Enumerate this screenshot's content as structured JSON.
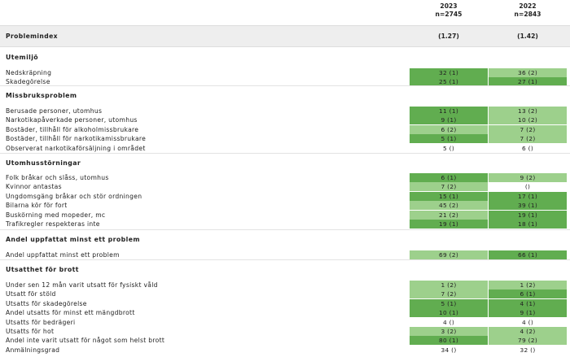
{
  "columns": [
    {
      "year": "2023",
      "n": "n=2745"
    },
    {
      "year": "2022",
      "n": "n=2843"
    }
  ],
  "problemindex": {
    "label": "Problemindex",
    "values": [
      "(1.27)",
      "(1.42)"
    ]
  },
  "colors": {
    "level1": "#61ad50",
    "level2": "#9dd08c",
    "none": "#ffffff",
    "band": "#eeeeee"
  },
  "sections": [
    {
      "title": "Utemiljö",
      "rows": [
        {
          "label": "Nedskräpning",
          "cells": [
            {
              "text": "32 (1)",
              "level": 1
            },
            {
              "text": "36 (2)",
              "level": 2
            }
          ]
        },
        {
          "label": "Skadegörelse",
          "cells": [
            {
              "text": "25 (1)",
              "level": 1
            },
            {
              "text": "27 (1)",
              "level": 1
            }
          ]
        }
      ]
    },
    {
      "title": "Missbruksproblem",
      "rows": [
        {
          "label": "Berusade personer, utomhus",
          "cells": [
            {
              "text": "11 (1)",
              "level": 1
            },
            {
              "text": "13 (2)",
              "level": 2
            }
          ]
        },
        {
          "label": "Narkotikapåverkade personer, utomhus",
          "cells": [
            {
              "text": "9 (1)",
              "level": 1
            },
            {
              "text": "10 (2)",
              "level": 2
            }
          ]
        },
        {
          "label": "Bostäder, tillhåll för alkoholmissbrukare",
          "cells": [
            {
              "text": "6 (2)",
              "level": 2
            },
            {
              "text": "7 (2)",
              "level": 2
            }
          ]
        },
        {
          "label": "Bostäder, tillhåll för narkotikamissbrukare",
          "cells": [
            {
              "text": "5 (1)",
              "level": 1
            },
            {
              "text": "7 (2)",
              "level": 2
            }
          ]
        },
        {
          "label": "Observerat narkotikaförsäljning i området",
          "cells": [
            {
              "text": "5 ()",
              "level": 0
            },
            {
              "text": "6 ()",
              "level": 0
            }
          ]
        }
      ]
    },
    {
      "title": "Utomhusstörningar",
      "rows": [
        {
          "label": "Folk bråkar och slåss, utomhus",
          "cells": [
            {
              "text": "6 (1)",
              "level": 1
            },
            {
              "text": "9 (2)",
              "level": 2
            }
          ]
        },
        {
          "label": "Kvinnor antastas",
          "cells": [
            {
              "text": "7 (2)",
              "level": 2
            },
            {
              "text": "()",
              "level": 0
            }
          ]
        },
        {
          "label": "Ungdomsgäng bråkar och stör ordningen",
          "cells": [
            {
              "text": "15 (1)",
              "level": 1
            },
            {
              "text": "17 (1)",
              "level": 1
            }
          ]
        },
        {
          "label": "Bilarna kör för fort",
          "cells": [
            {
              "text": "45 (2)",
              "level": 2
            },
            {
              "text": "39 (1)",
              "level": 1
            }
          ]
        },
        {
          "label": "Buskörning med mopeder, mc",
          "cells": [
            {
              "text": "21 (2)",
              "level": 2
            },
            {
              "text": "19 (1)",
              "level": 1
            }
          ]
        },
        {
          "label": "Trafikregler respekteras inte",
          "cells": [
            {
              "text": "19 (1)",
              "level": 1
            },
            {
              "text": "18 (1)",
              "level": 1
            }
          ]
        }
      ]
    },
    {
      "title": "Andel uppfattat minst ett problem",
      "rows": [
        {
          "label": "Andel uppfattat minst ett problem",
          "cells": [
            {
              "text": "69 (2)",
              "level": 2
            },
            {
              "text": "66 (1)",
              "level": 1
            }
          ]
        }
      ]
    },
    {
      "title": "Utsatthet för brott",
      "rows": [
        {
          "label": "Under sen 12 mån varit utsatt för fysiskt våld",
          "cells": [
            {
              "text": "1 (2)",
              "level": 2
            },
            {
              "text": "1 (2)",
              "level": 2
            }
          ]
        },
        {
          "label": "Utsatt för stöld",
          "cells": [
            {
              "text": "7 (2)",
              "level": 2
            },
            {
              "text": "6 (1)",
              "level": 1
            }
          ]
        },
        {
          "label": "Utsatts för skadegörelse",
          "cells": [
            {
              "text": "5 (1)",
              "level": 1
            },
            {
              "text": "4 (1)",
              "level": 1
            }
          ]
        },
        {
          "label": "Andel utsatts för minst ett mängdbrott",
          "cells": [
            {
              "text": "10 (1)",
              "level": 1
            },
            {
              "text": "9 (1)",
              "level": 1
            }
          ]
        },
        {
          "label": "Utsatts för bedrägeri",
          "cells": [
            {
              "text": "4 ()",
              "level": 0
            },
            {
              "text": "4 ()",
              "level": 0
            }
          ]
        },
        {
          "label": "Utsatts för hot",
          "cells": [
            {
              "text": "3 (2)",
              "level": 2
            },
            {
              "text": "4 (2)",
              "level": 2
            }
          ]
        },
        {
          "label": "Andel inte varit utsatt för något som helst brott",
          "cells": [
            {
              "text": "80 (1)",
              "level": 1
            },
            {
              "text": "79 (2)",
              "level": 2
            }
          ]
        },
        {
          "label": "Anmälningsgrad",
          "cells": [
            {
              "text": "34 ()",
              "level": 0
            },
            {
              "text": "32 ()",
              "level": 0
            }
          ]
        }
      ]
    }
  ]
}
